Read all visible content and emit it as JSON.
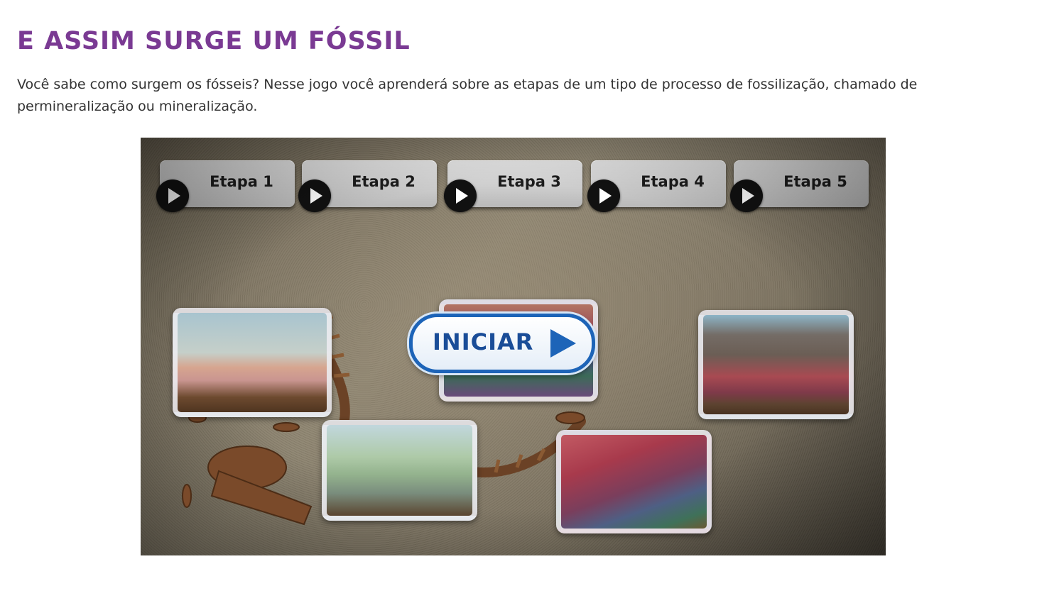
{
  "page": {
    "title": "E ASSIM SURGE UM FÓSSIL",
    "intro": "Você sabe como surgem os fósseis? Nesse jogo você aprenderá sobre as etapas de um tipo de processo de fossilização, chamado de permineralização ou mineralização."
  },
  "game": {
    "stages": [
      {
        "label": "Etapa 1",
        "icon": "play-icon"
      },
      {
        "label": "Etapa 2",
        "icon": "play-icon"
      },
      {
        "label": "Etapa 3",
        "icon": "play-icon"
      },
      {
        "label": "Etapa 4",
        "icon": "play-icon"
      },
      {
        "label": "Etapa 5",
        "icon": "play-icon"
      }
    ],
    "start_button": {
      "label": "INICIAR",
      "icon": "play-arrow-icon"
    }
  },
  "colors": {
    "title": "#7a3a93",
    "text": "#333333",
    "start_border": "#1d64b8",
    "start_text": "#1a4d98"
  }
}
